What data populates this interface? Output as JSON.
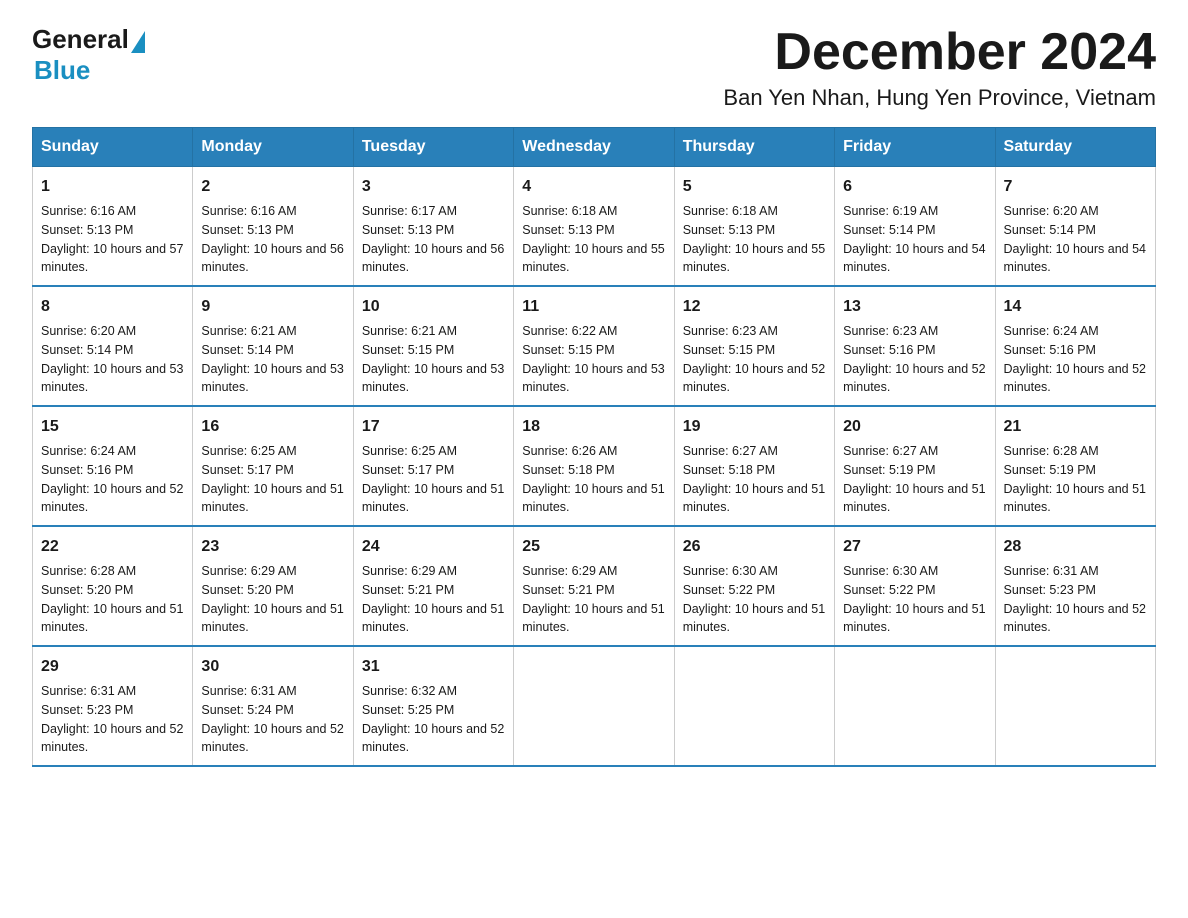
{
  "header": {
    "logo": {
      "general": "General",
      "blue": "Blue"
    },
    "month_title": "December 2024",
    "location": "Ban Yen Nhan, Hung Yen Province, Vietnam"
  },
  "days_of_week": [
    "Sunday",
    "Monday",
    "Tuesday",
    "Wednesday",
    "Thursday",
    "Friday",
    "Saturday"
  ],
  "weeks": [
    [
      {
        "day": "1",
        "sunrise": "6:16 AM",
        "sunset": "5:13 PM",
        "daylight": "10 hours and 57 minutes."
      },
      {
        "day": "2",
        "sunrise": "6:16 AM",
        "sunset": "5:13 PM",
        "daylight": "10 hours and 56 minutes."
      },
      {
        "day": "3",
        "sunrise": "6:17 AM",
        "sunset": "5:13 PM",
        "daylight": "10 hours and 56 minutes."
      },
      {
        "day": "4",
        "sunrise": "6:18 AM",
        "sunset": "5:13 PM",
        "daylight": "10 hours and 55 minutes."
      },
      {
        "day": "5",
        "sunrise": "6:18 AM",
        "sunset": "5:13 PM",
        "daylight": "10 hours and 55 minutes."
      },
      {
        "day": "6",
        "sunrise": "6:19 AM",
        "sunset": "5:14 PM",
        "daylight": "10 hours and 54 minutes."
      },
      {
        "day": "7",
        "sunrise": "6:20 AM",
        "sunset": "5:14 PM",
        "daylight": "10 hours and 54 minutes."
      }
    ],
    [
      {
        "day": "8",
        "sunrise": "6:20 AM",
        "sunset": "5:14 PM",
        "daylight": "10 hours and 53 minutes."
      },
      {
        "day": "9",
        "sunrise": "6:21 AM",
        "sunset": "5:14 PM",
        "daylight": "10 hours and 53 minutes."
      },
      {
        "day": "10",
        "sunrise": "6:21 AM",
        "sunset": "5:15 PM",
        "daylight": "10 hours and 53 minutes."
      },
      {
        "day": "11",
        "sunrise": "6:22 AM",
        "sunset": "5:15 PM",
        "daylight": "10 hours and 53 minutes."
      },
      {
        "day": "12",
        "sunrise": "6:23 AM",
        "sunset": "5:15 PM",
        "daylight": "10 hours and 52 minutes."
      },
      {
        "day": "13",
        "sunrise": "6:23 AM",
        "sunset": "5:16 PM",
        "daylight": "10 hours and 52 minutes."
      },
      {
        "day": "14",
        "sunrise": "6:24 AM",
        "sunset": "5:16 PM",
        "daylight": "10 hours and 52 minutes."
      }
    ],
    [
      {
        "day": "15",
        "sunrise": "6:24 AM",
        "sunset": "5:16 PM",
        "daylight": "10 hours and 52 minutes."
      },
      {
        "day": "16",
        "sunrise": "6:25 AM",
        "sunset": "5:17 PM",
        "daylight": "10 hours and 51 minutes."
      },
      {
        "day": "17",
        "sunrise": "6:25 AM",
        "sunset": "5:17 PM",
        "daylight": "10 hours and 51 minutes."
      },
      {
        "day": "18",
        "sunrise": "6:26 AM",
        "sunset": "5:18 PM",
        "daylight": "10 hours and 51 minutes."
      },
      {
        "day": "19",
        "sunrise": "6:27 AM",
        "sunset": "5:18 PM",
        "daylight": "10 hours and 51 minutes."
      },
      {
        "day": "20",
        "sunrise": "6:27 AM",
        "sunset": "5:19 PM",
        "daylight": "10 hours and 51 minutes."
      },
      {
        "day": "21",
        "sunrise": "6:28 AM",
        "sunset": "5:19 PM",
        "daylight": "10 hours and 51 minutes."
      }
    ],
    [
      {
        "day": "22",
        "sunrise": "6:28 AM",
        "sunset": "5:20 PM",
        "daylight": "10 hours and 51 minutes."
      },
      {
        "day": "23",
        "sunrise": "6:29 AM",
        "sunset": "5:20 PM",
        "daylight": "10 hours and 51 minutes."
      },
      {
        "day": "24",
        "sunrise": "6:29 AM",
        "sunset": "5:21 PM",
        "daylight": "10 hours and 51 minutes."
      },
      {
        "day": "25",
        "sunrise": "6:29 AM",
        "sunset": "5:21 PM",
        "daylight": "10 hours and 51 minutes."
      },
      {
        "day": "26",
        "sunrise": "6:30 AM",
        "sunset": "5:22 PM",
        "daylight": "10 hours and 51 minutes."
      },
      {
        "day": "27",
        "sunrise": "6:30 AM",
        "sunset": "5:22 PM",
        "daylight": "10 hours and 51 minutes."
      },
      {
        "day": "28",
        "sunrise": "6:31 AM",
        "sunset": "5:23 PM",
        "daylight": "10 hours and 52 minutes."
      }
    ],
    [
      {
        "day": "29",
        "sunrise": "6:31 AM",
        "sunset": "5:23 PM",
        "daylight": "10 hours and 52 minutes."
      },
      {
        "day": "30",
        "sunrise": "6:31 AM",
        "sunset": "5:24 PM",
        "daylight": "10 hours and 52 minutes."
      },
      {
        "day": "31",
        "sunrise": "6:32 AM",
        "sunset": "5:25 PM",
        "daylight": "10 hours and 52 minutes."
      },
      null,
      null,
      null,
      null
    ]
  ],
  "labels": {
    "sunrise": "Sunrise:",
    "sunset": "Sunset:",
    "daylight": "Daylight:"
  }
}
